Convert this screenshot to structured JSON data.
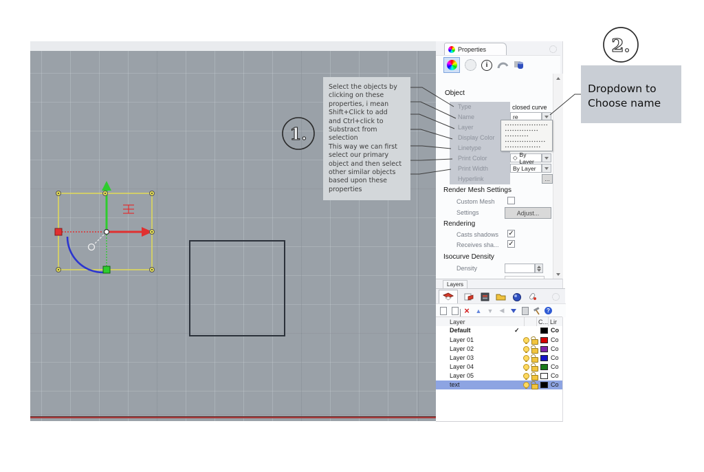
{
  "colors": {
    "selection_yellow": "#e3dc55",
    "gumball_green": "#2ecc2e",
    "gumball_red": "#e03030",
    "arc_blue": "#2b35cf",
    "axis_red": "#a83c3c",
    "selected_row_blue": "#8da4e2",
    "hatch_red": "#e03030"
  },
  "annotations": {
    "badge1": "1.",
    "badge2": "2.",
    "callout": "Select the objects by\nclicking on these\nproperties, i mean\nShift+Click to add\nand Ctrl+click to\nSubstract from\nselection\nThis way we can first\nselect our primary\nobject and then select\nother similar objects\nbased upon these\nproperties",
    "note": "Dropdown to\nChoose name"
  },
  "properties_panel": {
    "tab_label": "Properties",
    "object": {
      "header": "Object",
      "labels": [
        "Type",
        "Name",
        "Layer",
        "Display Color",
        "Linetype",
        "Print Color",
        "Print Width",
        "Hyperlink"
      ],
      "type_value": "closed curve",
      "name_value": "re",
      "print_color_value": "By Layer",
      "print_width_value": "By Layer",
      "hyperlink_button": "..."
    },
    "render_mesh": {
      "header": "Render Mesh Settings",
      "custom_mesh_label": "Custom Mesh",
      "custom_mesh_checked": false,
      "settings_label": "Settings",
      "adjust_button": "Adjust..."
    },
    "rendering": {
      "header": "Rendering",
      "casts_shadows_label": "Casts shadows",
      "casts_shadows_checked": true,
      "receives_shadows_label": "Receives sha...",
      "receives_shadows_checked": true
    },
    "isocurve": {
      "header": "Isocurve Density",
      "density_label": "Density",
      "density_value": ""
    }
  },
  "layers_panel": {
    "tab_label": "Layers",
    "columns": {
      "layer": "Layer",
      "color": "C...",
      "linetype": "Lir"
    },
    "rows": [
      {
        "name": "Default",
        "linetype": "Co",
        "color": "#000000",
        "current_mark": "✓"
      },
      {
        "name": "Layer 01",
        "linetype": "Co",
        "color": "#d40000"
      },
      {
        "name": "Layer 02",
        "linetype": "Co",
        "color": "#7d26a8"
      },
      {
        "name": "Layer 03",
        "linetype": "Co",
        "color": "#1414c8"
      },
      {
        "name": "Layer 04",
        "linetype": "Co",
        "color": "#1a7a1a"
      },
      {
        "name": "Layer 05",
        "linetype": "Co",
        "color": "#ffffff"
      },
      {
        "name": "text",
        "linetype": "Co",
        "color": "#000000"
      }
    ]
  },
  "glyphs": {
    "check": "✓",
    "diamond": "◇",
    "delete": "×",
    "up": "▲",
    "down": "▼",
    "left": "◀",
    "help": "?"
  }
}
